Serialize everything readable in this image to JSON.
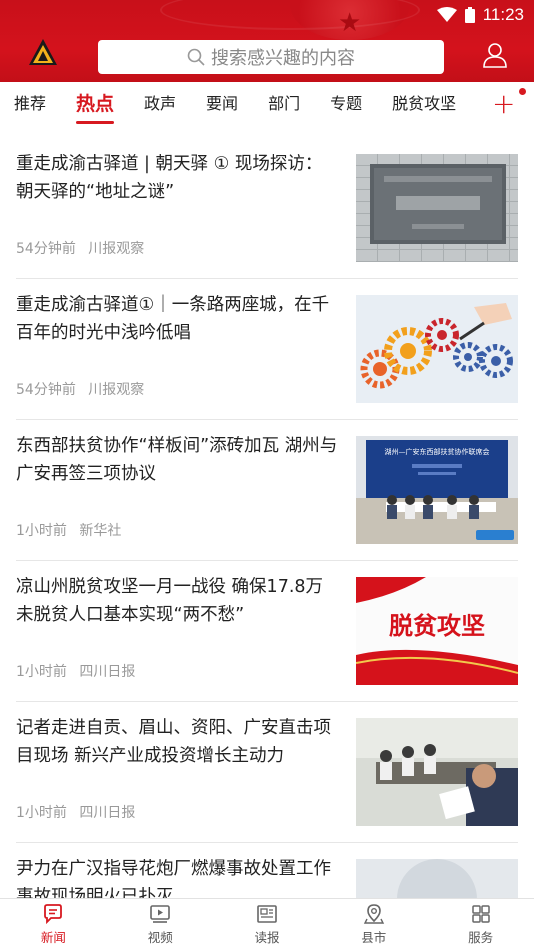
{
  "status_bar": {
    "time": "11:23"
  },
  "header": {
    "search_placeholder": "搜索感兴趣的内容"
  },
  "tabs": [
    {
      "label": "推荐"
    },
    {
      "label": "热点",
      "active": true
    },
    {
      "label": "政声"
    },
    {
      "label": "要闻"
    },
    {
      "label": "部门"
    },
    {
      "label": "专题"
    },
    {
      "label": "脱贫攻坚"
    }
  ],
  "news": [
    {
      "title": "重走成渝古驿道 | 朝天驿 ① 现场探访：朝天驿的“地址之谜”",
      "time": "54分钟前",
      "source": "川报观察",
      "thumb": "stone-plaque"
    },
    {
      "title": "重走成渝古驿道①｜一条路两座城，在千百年的时光中浅吟低唱",
      "time": "54分钟前",
      "source": "川报观察",
      "thumb": "gears"
    },
    {
      "title": "东西部扶贫协作“样板间”添砖加瓦 湖州与广安再签三项协议",
      "time": "1小时前",
      "source": "新华社",
      "thumb": "meeting-room",
      "thumb_banner": "湖州—广安东西部扶贫协作联席会"
    },
    {
      "title": "凉山州脱贫攻坚一月一战役 确保17.8万未脱贫人口基本实现“两不愁”",
      "time": "1小时前",
      "source": "四川日报",
      "thumb": "poverty-banner",
      "thumb_text": "脱贫攻坚"
    },
    {
      "title": "记者走进自贡、眉山、资阳、广安直击项目现场 新兴产业成投资增长主动力",
      "time": "1小时前",
      "source": "四川日报",
      "thumb": "office-meeting"
    },
    {
      "title": "尹力在广汉指导花炮厂燃爆事故处置工作 事故现场明火已扑灭",
      "time": "",
      "source": "",
      "thumb": "blurred"
    }
  ],
  "bottom_nav": [
    {
      "label": "新闻",
      "icon": "chat-icon",
      "active": true
    },
    {
      "label": "视频",
      "icon": "video-icon"
    },
    {
      "label": "读报",
      "icon": "newspaper-icon"
    },
    {
      "label": "县市",
      "icon": "location-icon"
    },
    {
      "label": "服务",
      "icon": "grid-icon"
    }
  ],
  "colors": {
    "brand_red": "#d71920",
    "header_red": "#c8101a"
  }
}
